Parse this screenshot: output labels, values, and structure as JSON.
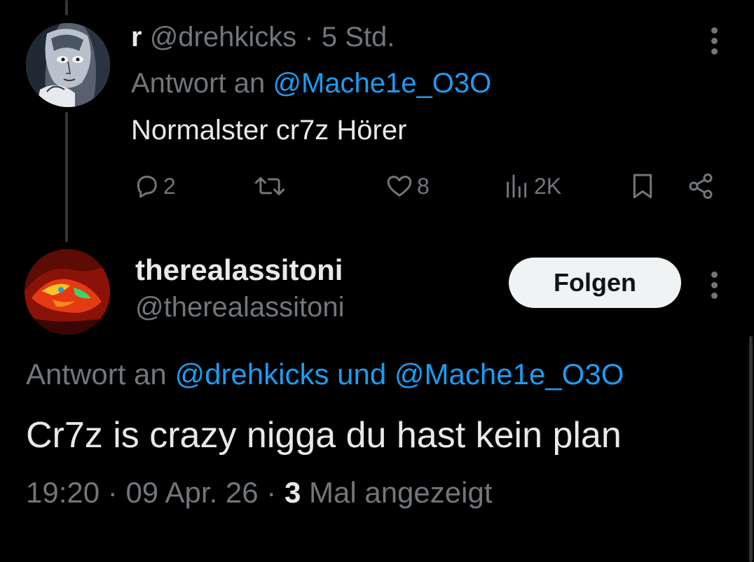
{
  "tweet1": {
    "display_name": "r",
    "handle": "@drehkicks",
    "separator": "·",
    "time": "5 Std.",
    "reply_prefix": "Antwort an",
    "reply_to": "@Mache1e_O3O",
    "text": "Normalster cr7z Hörer",
    "actions": {
      "replies": "2",
      "reposts": "",
      "likes": "8",
      "views": "2K"
    }
  },
  "tweet2": {
    "display_name": "therealassitoni",
    "handle": "@therealassitoni",
    "follow_label": "Folgen",
    "reply_prefix": "Antwort an",
    "reply_to_1": "@drehkicks",
    "reply_joiner": "und",
    "reply_to_2": "@Mache1e_O3O",
    "text": "Cr7z is crazy nigga du hast kein plan",
    "time": "19:20",
    "separator": "·",
    "date": "09 Apr. 26",
    "views_count": "3",
    "views_label": "Mal angezeigt"
  },
  "colors": {
    "background": "#000000",
    "text": "#e7e9ea",
    "muted": "#71767b",
    "link": "#1d9bf0",
    "button_bg": "#eff3f4"
  },
  "icons": [
    "reply-icon",
    "repost-icon",
    "like-icon",
    "views-icon",
    "bookmark-icon",
    "share-icon",
    "more-icon"
  ]
}
